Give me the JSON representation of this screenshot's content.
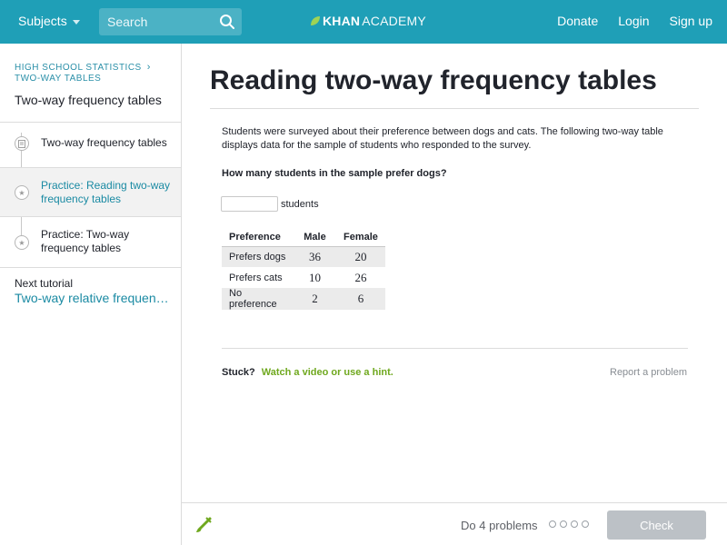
{
  "header": {
    "subjects_label": "Subjects",
    "search_placeholder": "Search",
    "logo_bold": "KHAN",
    "logo_light": "ACADEMY",
    "donate_label": "Donate",
    "login_label": "Login",
    "signup_label": "Sign up"
  },
  "sidebar": {
    "breadcrumb_course": "HIGH SCHOOL STATISTICS",
    "breadcrumb_unit": "TWO-WAY TABLES",
    "tutorial_title": "Two-way frequency tables",
    "items": [
      {
        "label": "Two-way frequency tables",
        "icon": "video-icon",
        "active": false
      },
      {
        "label": "Practice: Reading two-way frequency tables",
        "icon": "star-icon",
        "active": true
      },
      {
        "label": "Practice: Two-way frequency tables",
        "icon": "star-icon",
        "active": false
      }
    ],
    "next_label": "Next tutorial",
    "next_link": "Two-way relative frequency tables"
  },
  "main": {
    "title": "Reading two-way frequency tables",
    "prompt": "Students were surveyed about their preference between dogs and cats. The following two-way table displays data for the sample of students who responded to the survey.",
    "question": "How many students in the sample prefer dogs?",
    "answer_value": "",
    "answer_unit": "students",
    "table": {
      "headers": [
        "Preference",
        "Male",
        "Female"
      ],
      "rows": [
        [
          "Prefers dogs",
          "36",
          "20"
        ],
        [
          "Prefers cats",
          "10",
          "26"
        ],
        [
          "No preference",
          "2",
          "6"
        ]
      ]
    },
    "stuck_label": "Stuck?",
    "hint_link": "Watch a video or use a hint.",
    "report_link": "Report a problem"
  },
  "footer": {
    "do_problems": "Do 4 problems",
    "check_label": "Check"
  },
  "colors": {
    "header_bg": "#1f9fb7",
    "link": "#1a8aa3",
    "hint_green": "#6fa81e",
    "check_disabled": "#bcc1c6"
  }
}
